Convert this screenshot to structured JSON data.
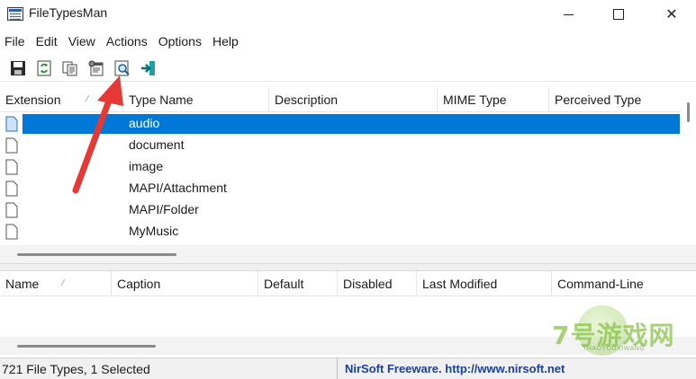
{
  "window": {
    "title": "FileTypesMan",
    "controls": {
      "minimize": "minimize-icon",
      "maximize": "maximize-icon",
      "close": "✕"
    }
  },
  "menu": [
    "File",
    "Edit",
    "View",
    "Actions",
    "Options",
    "Help"
  ],
  "toolbar": {
    "icons": [
      "save-icon",
      "refresh-icon",
      "copy-icon",
      "properties-icon",
      "find-icon",
      "exit-icon"
    ]
  },
  "upper_list": {
    "columns": [
      "Extension",
      "Type Name",
      "Description",
      "MIME Type",
      "Perceived Type"
    ],
    "sort_indicator": "⁄",
    "rows": [
      {
        "type_name": "audio",
        "selected": true
      },
      {
        "type_name": "document",
        "selected": false
      },
      {
        "type_name": "image",
        "selected": false
      },
      {
        "type_name": "MAPI/Attachment",
        "selected": false
      },
      {
        "type_name": "MAPI/Folder",
        "selected": false
      },
      {
        "type_name": "MyMusic",
        "selected": false
      }
    ]
  },
  "lower_list": {
    "columns": [
      "Name",
      "Caption",
      "Default",
      "Disabled",
      "Last Modified",
      "Command-Line"
    ],
    "sort_indicator": "⁄"
  },
  "status": {
    "left": "721 File Types, 1 Selected",
    "right": "NirSoft Freeware.  http://www.nirsoft.net"
  },
  "colors": {
    "selection": "#0078d7",
    "annotation_arrow": "#e53935",
    "status_link": "#1a3f9e"
  },
  "watermark": {
    "text": "7号游戏网",
    "sub": "THAOYOUXIWANG"
  }
}
